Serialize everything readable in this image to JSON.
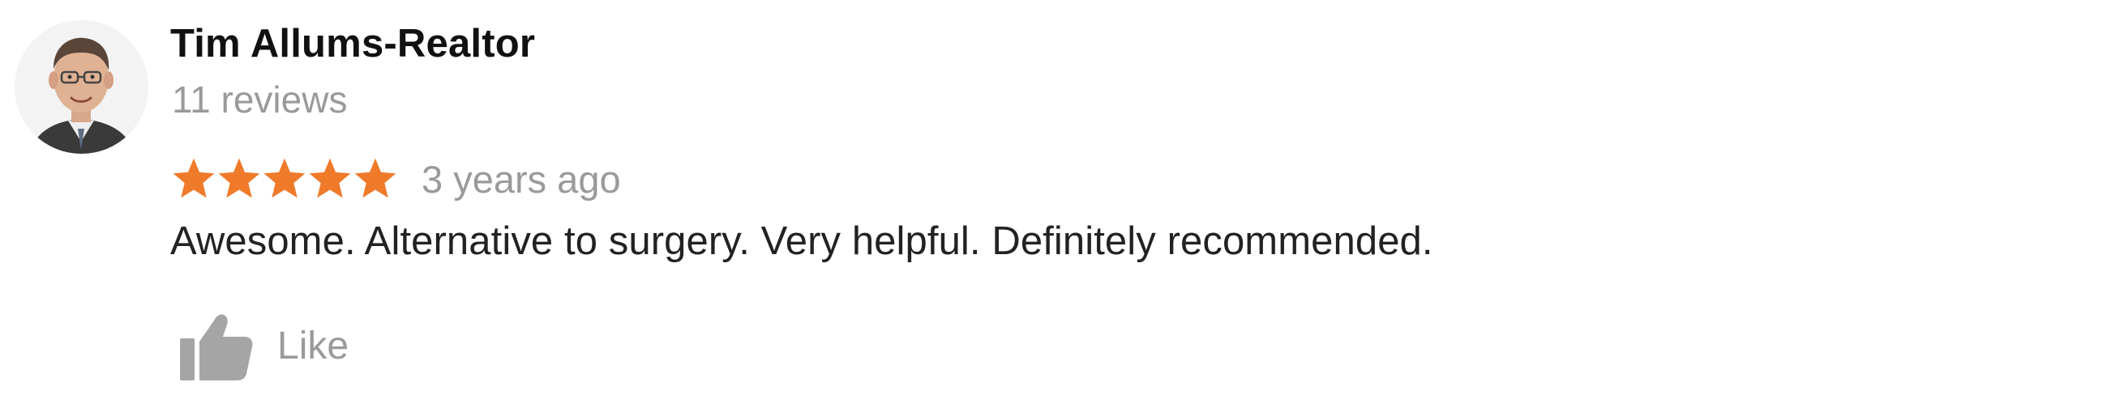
{
  "review": {
    "reviewer_name": "Tim Allums-Realtor",
    "review_count": "11 reviews",
    "rating": 5,
    "rating_max": 5,
    "date": "3 years ago",
    "text": "Awesome. Alternative to surgery. Very helpful. Definitely recommended.",
    "like_label": "Like"
  },
  "colors": {
    "star": "#ef7a2a",
    "muted_text": "#9a9a9a",
    "like_icon": "#a5a5a5"
  },
  "icons": {
    "avatar": "user-avatar-photo",
    "star": "star-icon",
    "like": "thumbs-up-icon"
  }
}
